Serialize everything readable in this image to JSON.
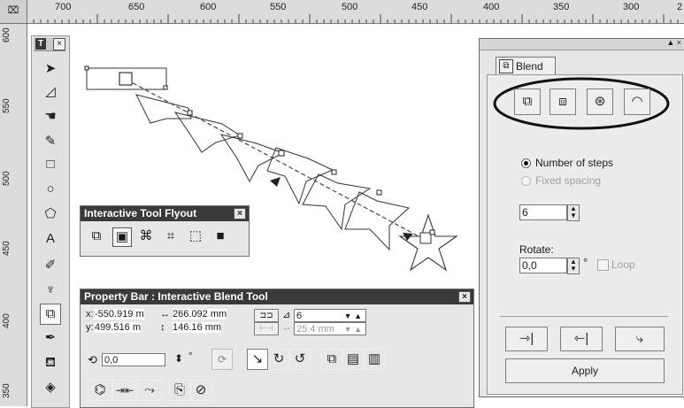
{
  "ruler": {
    "corner": "⌧",
    "horizontal": [
      "700",
      "650",
      "600",
      "550",
      "500",
      "450",
      "400",
      "350",
      "300",
      "2"
    ],
    "vertical": [
      "600",
      "550",
      "500",
      "450",
      "400",
      "350"
    ]
  },
  "toolbox": {
    "title": "T",
    "close": "×",
    "tools": [
      {
        "name": "pick-tool-icon",
        "glyph": "➤"
      },
      {
        "name": "shape-tool-icon",
        "glyph": "◿"
      },
      {
        "name": "pan-hand-tool-icon",
        "glyph": "☚"
      },
      {
        "name": "freehand-tool-icon",
        "glyph": "✎"
      },
      {
        "name": "rectangle-tool-icon",
        "glyph": "□"
      },
      {
        "name": "ellipse-tool-icon",
        "glyph": "○"
      },
      {
        "name": "polygon-tool-icon",
        "glyph": "⬠"
      },
      {
        "name": "text-tool-icon",
        "glyph": "A"
      },
      {
        "name": "eyedropper-tool-icon",
        "glyph": "✐"
      },
      {
        "name": "outline-tool-icon",
        "glyph": "♆"
      },
      {
        "name": "interactive-blend-tool-icon",
        "glyph": "⧉"
      },
      {
        "name": "pen-tool-icon",
        "glyph": "✒"
      },
      {
        "name": "fill-tool-icon",
        "glyph": "⛾"
      },
      {
        "name": "interactive-fill-tool-icon",
        "glyph": "◈"
      }
    ]
  },
  "flyout": {
    "title": "Interactive Tool Flyout",
    "close": "×",
    "icons": [
      "⧉",
      "▣",
      "⌘",
      "⌗",
      "⬚",
      "■"
    ]
  },
  "property_bar": {
    "title": "Property Bar : Interactive Blend Tool",
    "close": "×",
    "x_label": "x:",
    "x_value": "-550.919 m",
    "y_label": "y:",
    "y_value": "499.516 m",
    "width_value": "266.092 mm",
    "height_value": "146.16 mm",
    "steps_value": "6",
    "spacing_value": "25.4 mm",
    "rotate_value": "0,0",
    "degree": "°"
  },
  "docker": {
    "tab_label": "Blend",
    "radio_steps": "Number of steps",
    "radio_spacing": "Fixed spacing",
    "steps_value": "6",
    "rotate_label": "Rotate:",
    "rotate_value": "0,0",
    "degree": "°",
    "loop_label": "Loop",
    "apply_label": "Apply",
    "pin": "▲ ×"
  }
}
